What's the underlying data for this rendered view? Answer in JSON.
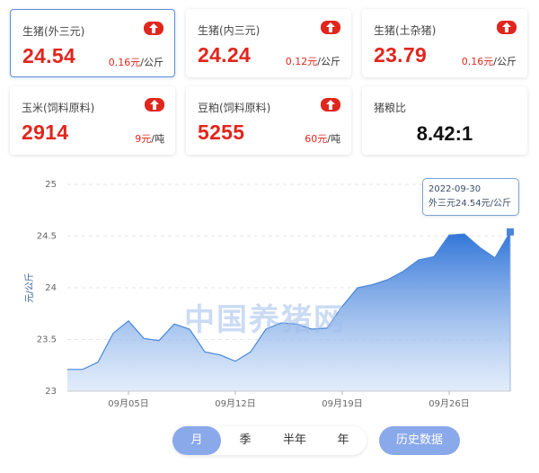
{
  "cards": [
    {
      "label": "生猪(外三元)",
      "price": "24.54",
      "change": "0.16元",
      "unit": "/公斤",
      "trend_icon": "arrow-up-icon"
    },
    {
      "label": "生猪(内三元)",
      "price": "24.24",
      "change": "0.12元",
      "unit": "/公斤",
      "trend_icon": "arrow-up-icon"
    },
    {
      "label": "生猪(土杂猪)",
      "price": "23.79",
      "change": "0.16元",
      "unit": "/公斤",
      "trend_icon": "arrow-up-icon"
    },
    {
      "label": "玉米(饲料原料)",
      "price": "2914",
      "change": "9元",
      "unit": "/吨",
      "trend_icon": "arrow-up-icon"
    },
    {
      "label": "豆粕(饲料原料)",
      "price": "5255",
      "change": "60元",
      "unit": "/吨",
      "trend_icon": "arrow-up-icon"
    },
    {
      "label": "猪粮比",
      "ratio": "8.42:1"
    }
  ],
  "colors": {
    "up": "#e0261d",
    "accent": "#8aa9ea",
    "line": "#4a86d8"
  },
  "tooltip": {
    "date": "2022-09-30",
    "text": "外三元24.54元/公斤"
  },
  "watermark": "中国养猪网",
  "period_buttons": [
    "月",
    "季",
    "半年",
    "年"
  ],
  "active_period": "月",
  "history_button": "历史数据",
  "chart_data": {
    "type": "area",
    "ylabel": "元/公斤",
    "ylim": [
      23,
      25
    ],
    "yticks": [
      "23",
      "23.5",
      "24",
      "24.5",
      "25"
    ],
    "xticks": [
      "09月05日",
      "09月12日",
      "09月19日",
      "09月26日"
    ],
    "grid": true,
    "x": [
      "2022-09-01",
      "2022-09-02",
      "2022-09-03",
      "2022-09-04",
      "2022-09-05",
      "2022-09-06",
      "2022-09-07",
      "2022-09-08",
      "2022-09-09",
      "2022-09-10",
      "2022-09-11",
      "2022-09-12",
      "2022-09-13",
      "2022-09-14",
      "2022-09-15",
      "2022-09-16",
      "2022-09-17",
      "2022-09-18",
      "2022-09-19",
      "2022-09-20",
      "2022-09-21",
      "2022-09-22",
      "2022-09-23",
      "2022-09-24",
      "2022-09-25",
      "2022-09-26",
      "2022-09-27",
      "2022-09-28",
      "2022-09-29",
      "2022-09-30"
    ],
    "series": [
      {
        "values": [
          23.21,
          23.21,
          23.28,
          23.56,
          23.68,
          23.51,
          23.49,
          23.65,
          23.6,
          23.38,
          23.35,
          23.29,
          23.38,
          23.6,
          23.66,
          23.65,
          23.6,
          23.61,
          23.82,
          24.0,
          24.03,
          24.08,
          24.16,
          24.27,
          24.3,
          24.51,
          24.52,
          24.39,
          24.29,
          24.54
        ]
      }
    ]
  }
}
